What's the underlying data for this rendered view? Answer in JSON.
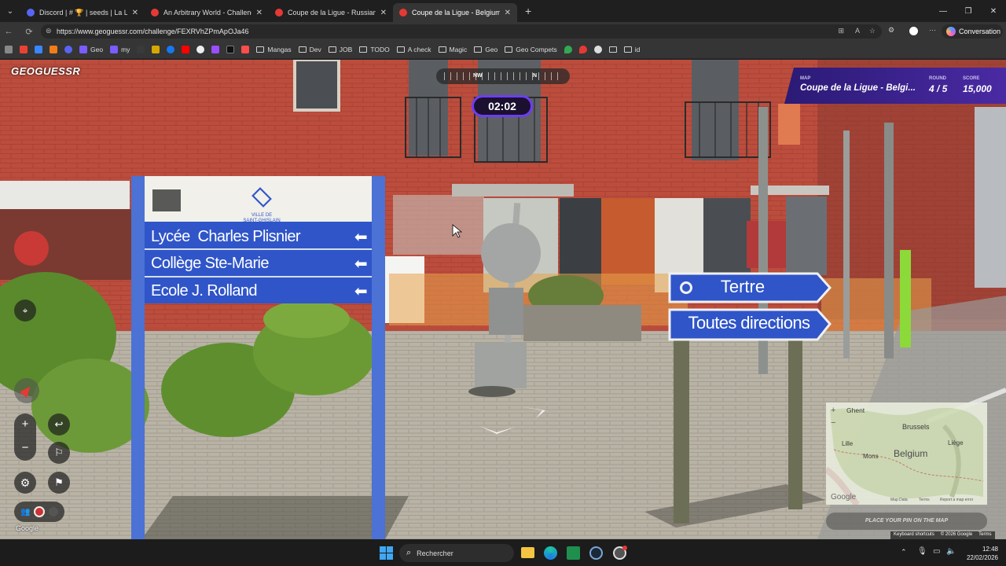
{
  "browser": {
    "tabs": [
      {
        "title": "Discord | # 🏆 | seeds | La Ligu",
        "favicon_color": "#5865f2"
      },
      {
        "title": "An Arbitrary World - Challenge - G",
        "favicon_color": "#e53935"
      },
      {
        "title": "Coupe de la Ligue - Russian Empir",
        "favicon_color": "#e53935"
      },
      {
        "title": "Coupe de la Ligue - Belgium - Cha",
        "favicon_color": "#e53935"
      }
    ],
    "active_tab": 3,
    "new_tab": "+",
    "url": "https://www.geoguessr.com/challenge/FEXRVhZPmApOJa46",
    "copilot_label": "Conversation",
    "bookmarks": [
      "Geo",
      "my",
      "Mangas",
      "Dev",
      "JOB",
      "TODO",
      "A check",
      "Magic",
      "Geo",
      "Geo Compets",
      "id"
    ]
  },
  "game": {
    "logo": "GEOGUESSR",
    "compass": {
      "nw": "NW",
      "n": "N"
    },
    "timer": "02:02",
    "map_label": "MAP",
    "map_name": "Coupe de la Ligue - Belgi...",
    "round_label": "ROUND",
    "round_value": "4 / 5",
    "score_label": "SCORE",
    "score_value": "15,000",
    "place_pin": "PLACE YOUR PIN ON THE MAP",
    "google": "Google",
    "terms": "Terms",
    "keyboard_shortcuts": "Keyboard shortcuts",
    "copyright": "© 2026 Google",
    "minimap": {
      "places": [
        "Ghent",
        "Brussels",
        "Lille",
        "Liège",
        "Mons",
        "Belgium"
      ],
      "map_data": "Map Data",
      "terms": "Terms",
      "report": "Report a map error",
      "google": "Google"
    }
  },
  "scene": {
    "sign_left": {
      "emblem_text": "VILLE DE\nSAINT-GHISLAIN",
      "rows": [
        "Lycée  Charles Plisnier",
        "Collège Ste-Marie",
        "Ecole J. Rolland"
      ]
    },
    "sign_right": {
      "rows": [
        "Tertre",
        "Toutes directions"
      ]
    }
  },
  "taskbar": {
    "search_placeholder": "Rechercher",
    "time": "12:48",
    "date": "22/02/2026"
  },
  "colors": {
    "sign_blue": "#2f55c8",
    "brick": "#b94b3c",
    "timer_border": "#6c3df4",
    "hud_panel": "#3a1f8a"
  }
}
